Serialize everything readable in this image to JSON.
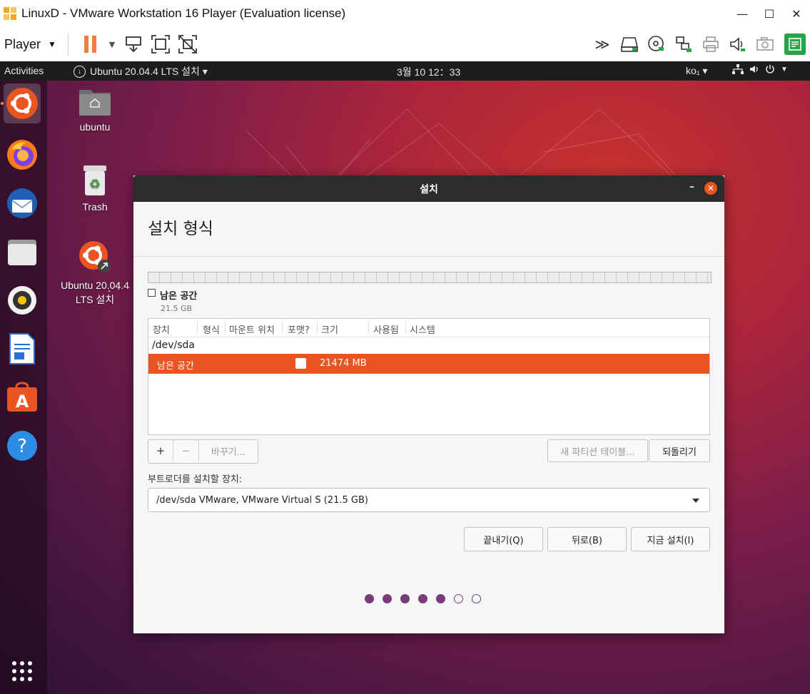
{
  "window": {
    "title": "LinuxD - VMware Workstation 16 Player (Evaluation license)",
    "minimize": "—",
    "maximize": "☐",
    "close": "✕"
  },
  "toolbar": {
    "player_label": "Player",
    "icons": [
      "pause-icon",
      "send-keys-icon",
      "fullscreen-icon",
      "unity-icon",
      "more-icon",
      "hdd-icon",
      "cd-icon",
      "network-icon",
      "printer-icon",
      "sound-icon",
      "camera-icon",
      "notes-icon"
    ]
  },
  "ubuntu_topbar": {
    "activities": "Activities",
    "app_menu": "Ubuntu 20.04.4 LTS 설치 ▾",
    "clock": "3월 10  12：33",
    "input_method": "ko₁ ▾"
  },
  "desktop": {
    "icons": [
      {
        "label": "ubuntu"
      },
      {
        "label": "Trash"
      },
      {
        "label": "Ubuntu 20.04.4 LTS 설치"
      }
    ]
  },
  "dialog": {
    "title": "설치",
    "page_title": "설치 형식",
    "legend_label": "남은 공간",
    "legend_size": "21.5 GB",
    "columns": [
      "장치",
      "형식",
      "마운트 위치",
      "포맷?",
      "크기",
      "사용됨",
      "시스템"
    ],
    "device": "/dev/sda",
    "selected_row": {
      "name": "남은 공간",
      "size": "21474 MB"
    },
    "add_btn": "+",
    "remove_btn": "−",
    "change_btn": "바꾸기...",
    "new_table_btn": "새 파티션 테이블...",
    "revert_btn": "되돌리기",
    "boot_label": "부트로더를 설치할 장치:",
    "boot_value": "/dev/sda VMware, VMware Virtual S (21.5 GB)",
    "quit_btn": "끝내기(Q)",
    "back_btn": "뒤로(B)",
    "install_btn": "지금 설치(I)",
    "progress": {
      "total": 7,
      "completed": 5
    }
  },
  "colors": {
    "accent": "#e95420",
    "progress_dot": "#7b3a78",
    "pause": "#f47c3c",
    "notes": "#27a34a"
  }
}
